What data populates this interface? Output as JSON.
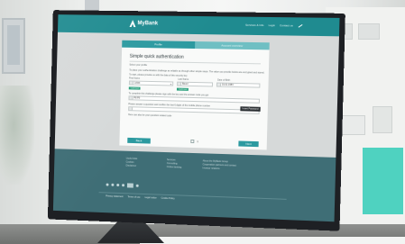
{
  "header": {
    "brand": "MyBank",
    "nav": [
      "Services & Info",
      "Login",
      "Contact us"
    ]
  },
  "tabs": [
    "Profile",
    "Account overview"
  ],
  "auth": {
    "title": "Simple quick authentication",
    "line1": "Select your profile",
    "line2": "To place your authentication challenge as reliable as through other simple steps. The value you provide below are encrypted and stored.",
    "line3": "To start, please provide us with the data of this security key",
    "labels": [
      "First Name",
      "Last Name",
      "Date of Birth"
    ],
    "values": [
      "Lukas",
      "Bauer",
      "01.01.1984"
    ],
    "tags": [
      "Confirmed",
      "Confirmed"
    ],
    "line4": "To complete this challenge please sign with the key and the answer code you got",
    "code": "P8 P9",
    "tooltip": "Insert Password",
    "line5": "Please answer a question and confirm the last 6 digits of the mobile phone number",
    "line6": "Here can also be your question related code",
    "back": "Back",
    "next": "Next",
    "page": "1"
  },
  "footer": {
    "col1": [
      "Useful links",
      "Cookies",
      "Disclaimer"
    ],
    "col2": [
      "Services",
      "Consulting",
      "Online banking"
    ],
    "col3": [
      "About the MyBank Group",
      "Cooperation partners and contact",
      "Investor relations"
    ],
    "links": [
      "Privacy statement",
      "Terms of use",
      "Legal notice",
      "Cookie Policy"
    ]
  },
  "colors": {
    "accent": "#2c9aa0",
    "header": "#1f8b90",
    "footer": "#3f6e76",
    "teal_block": "#4fd2c0"
  }
}
